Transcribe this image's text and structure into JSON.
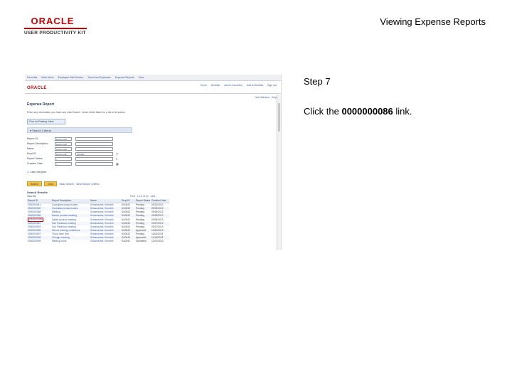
{
  "brand": {
    "logo_text": "ORACLE",
    "logo_sub": "USER PRODUCTIVITY KIT"
  },
  "slide": {
    "title": "Viewing Expense Reports",
    "step_label": "Step 7",
    "instruction_prefix": "Click the ",
    "instruction_target": "0000000086",
    "instruction_suffix": " link."
  },
  "app": {
    "toolbar_items": [
      "Favorites",
      "Main Menu",
      "Employee Self-Service",
      "Travel and Expenses",
      "Expense Reports",
      "View"
    ],
    "header_logo": "ORACLE",
    "header_links": [
      "Home",
      "Worklist",
      "Add to Favorites",
      "Add to Worklist",
      "Sign out"
    ],
    "util_links": [
      "New Window",
      "Help"
    ],
    "page_title": "Expense Report",
    "instructions": "Enter any information you have and click Search. Leave fields blank for a list of all values.",
    "tab_label": "Find an Existing Value",
    "search_section": "Search Criteria",
    "criteria": [
      {
        "label": "Report ID:",
        "operator": "begins with",
        "value": ""
      },
      {
        "label": "Report Description:",
        "operator": "begins with",
        "value": ""
      },
      {
        "label": "Name:",
        "operator": "begins with",
        "value": ""
      },
      {
        "label": "Empl ID:",
        "operator": "begins with",
        "value": "KU0001"
      },
      {
        "label": "Report Status:",
        "operator": "=",
        "value": ""
      },
      {
        "label": "Creation Date:",
        "operator": "=",
        "value": ""
      }
    ],
    "case_sensitive": "Case Sensitive",
    "search_button": "Search",
    "clear_button": "Clear",
    "basic_search": "Basic Search",
    "save_search": "Save Search Criteria",
    "results_title": "Search Results",
    "results_subtitle": "View All",
    "results_nav": [
      "First",
      "1-10 of 10",
      "Last"
    ],
    "columns": [
      "Report ID",
      "Report Description",
      "Name",
      "Empl ID",
      "Report Status",
      "Creation Date"
    ],
    "rows": [
      [
        "0000000041",
        "Consultant product sales",
        "Schumacher, Kenneth",
        "KU0042",
        "Pending",
        "09/22/2013"
      ],
      [
        "0000000050",
        "Consultant product sales",
        "Schumacher, Kenneth",
        "KU0042",
        "Pending",
        "09/23/2013"
      ],
      [
        "0000000068",
        "Meeting",
        "Schumacher, Kenneth",
        "KU0042",
        "Pending",
        "09/25/2013"
      ],
      [
        "0000000069",
        "Boston product meeting",
        "Schumacher, Kenneth",
        "KU0042",
        "Pending",
        "09/26/2013"
      ],
      [
        "0000000086",
        "Dallas product meeting",
        "Schumacher, Kenneth",
        "KU0042",
        "Pending",
        "09/26/2013"
      ],
      [
        "0000000087",
        "San Francisco meeting",
        "Schumacher, Kenneth",
        "KU0042",
        "Pending",
        "09/27/2013"
      ],
      [
        "0000000094",
        "Sun Francisco meeting",
        "Schumacher, Kenneth",
        "KU0042",
        "Pending",
        "09/27/2013"
      ],
      [
        "0000000095",
        "Denver training conference",
        "Schumacher, Kenneth",
        "KU0042",
        "Approved",
        "10/20/2013"
      ],
      [
        "0000000097",
        "Trip to New York",
        "Schumacher, Kenneth",
        "KU0042",
        "Pending",
        "11/04/2013"
      ],
      [
        "0000000098",
        "Chicago meeting",
        "Schumacher, Kenneth",
        "KU0042",
        "Approved",
        "11/15/2013"
      ],
      [
        "0000000099",
        "Meeting costs",
        "Schumacher, Kenneth",
        "KU0042",
        "Submitted",
        "12/01/2013"
      ]
    ]
  }
}
